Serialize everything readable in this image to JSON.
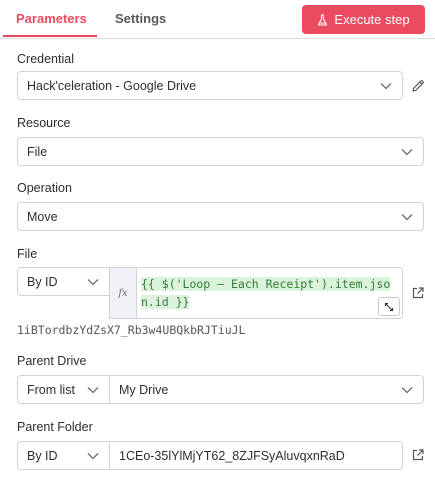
{
  "tabs": {
    "parameters": "Parameters",
    "settings": "Settings"
  },
  "execute_button": "Execute step",
  "credential": {
    "label": "Credential",
    "value": "Hack'celeration - Google Drive"
  },
  "resource": {
    "label": "Resource",
    "value": "File"
  },
  "operation": {
    "label": "Operation",
    "value": "Move"
  },
  "file": {
    "label": "File",
    "mode": "By ID",
    "fx": "fx",
    "expression_line1": "{{ $('Loop – Each Receipt').item.jso",
    "expression_line2": "n.id }}",
    "resolved": "1iBTordbzYdZsX7_Rb3w4UBQkbRJTiuJL"
  },
  "parent_drive": {
    "label": "Parent Drive",
    "mode": "From list",
    "value": "My Drive"
  },
  "parent_folder": {
    "label": "Parent Folder",
    "mode": "By ID",
    "value": "1CEo-35lYlMjYT62_8ZJFSyAluvqxnRaD"
  },
  "colors": {
    "accent": "#ea4b5f",
    "expression_text": "#2f7d32",
    "expression_bg": "#dcf2dc"
  },
  "icons": [
    "flask-icon",
    "pencil-icon",
    "chevron-down-icon",
    "external-link-icon",
    "expand-icon"
  ]
}
